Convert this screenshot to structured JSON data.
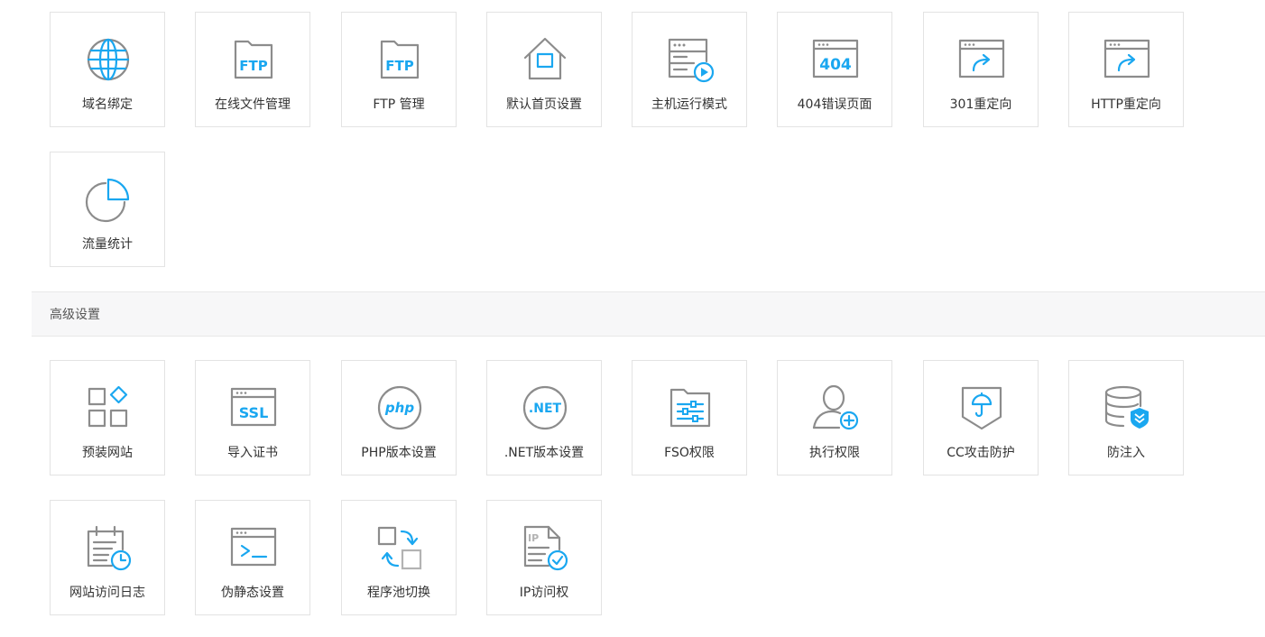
{
  "basic": {
    "items": [
      {
        "label": "域名绑定",
        "icon": "globe-icon"
      },
      {
        "label": "在线文件管理",
        "icon": "ftp-folder-icon"
      },
      {
        "label": "FTP 管理",
        "icon": "ftp-folder-icon"
      },
      {
        "label": "默认首页设置",
        "icon": "home-icon"
      },
      {
        "label": "主机运行模式",
        "icon": "server-play-icon"
      },
      {
        "label": "404错误页面",
        "icon": "error-404-icon"
      },
      {
        "label": "301重定向",
        "icon": "redirect-window-icon"
      },
      {
        "label": "HTTP重定向",
        "icon": "redirect-window-icon"
      },
      {
        "label": "流量统计",
        "icon": "pie-chart-icon"
      }
    ],
    "icon_text": {
      "ftp": "FTP",
      "e404": "404"
    }
  },
  "advanced": {
    "title": "高级设置",
    "items": [
      {
        "label": "预装网站",
        "icon": "apps-grid-icon"
      },
      {
        "label": "导入证书",
        "icon": "ssl-certificate-icon"
      },
      {
        "label": "PHP版本设置",
        "icon": "php-icon"
      },
      {
        "label": ".NET版本设置",
        "icon": "dotnet-icon"
      },
      {
        "label": "FSO权限",
        "icon": "folder-settings-icon"
      },
      {
        "label": "执行权限",
        "icon": "user-add-icon"
      },
      {
        "label": "CC攻击防护",
        "icon": "shield-umbrella-icon"
      },
      {
        "label": "防注入",
        "icon": "database-shield-icon"
      },
      {
        "label": "网站访问日志",
        "icon": "log-clock-icon"
      },
      {
        "label": "伪静态设置",
        "icon": "terminal-icon"
      },
      {
        "label": "程序池切换",
        "icon": "swap-icon"
      },
      {
        "label": "IP访问权",
        "icon": "ip-check-icon"
      }
    ],
    "icon_text": {
      "ssl": "SSL",
      "php": "php",
      "dotnet": ".NET",
      "ip": "IP"
    }
  },
  "colors": {
    "accent": "#1aa7f0",
    "icon_gray": "#8c8c8c",
    "border": "#e3e3e3",
    "header_bg": "#f7f7f8"
  }
}
